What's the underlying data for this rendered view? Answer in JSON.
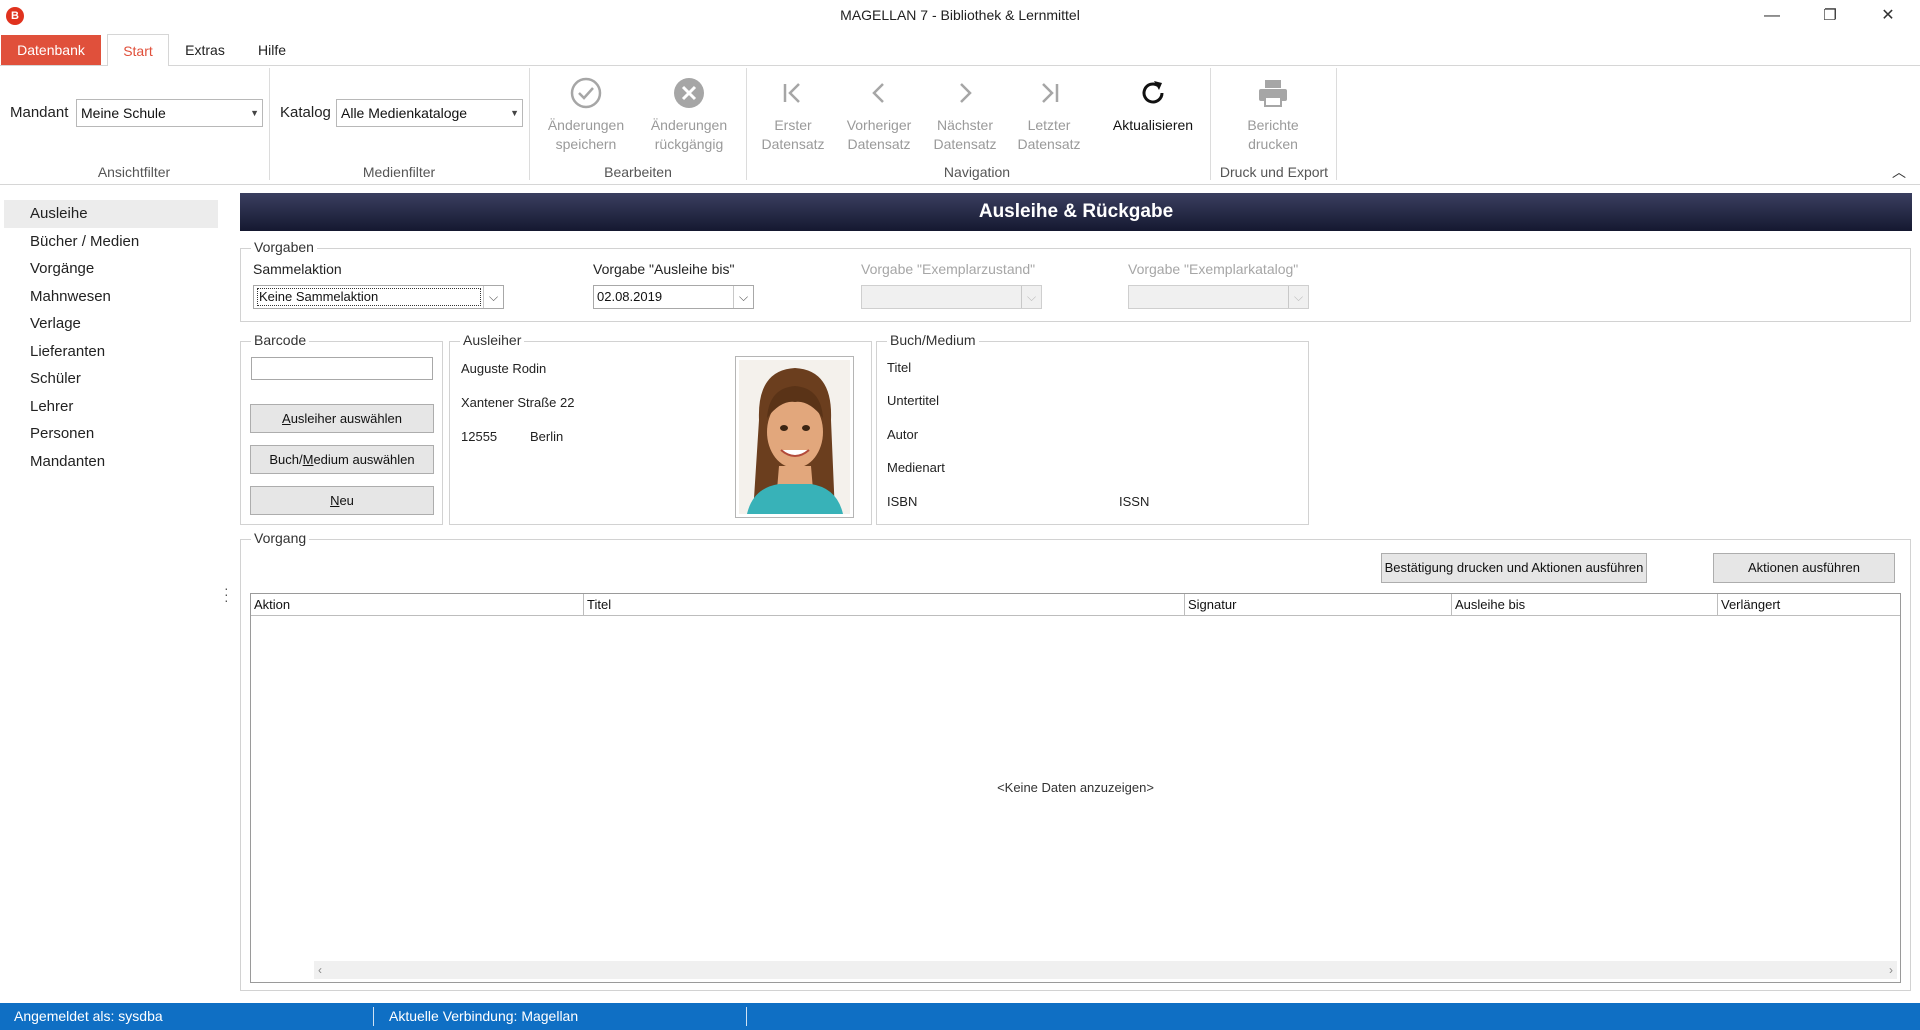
{
  "window": {
    "title": "MAGELLAN 7 - Bibliothek & Lernmittel",
    "app_icon_letter": "B",
    "minimize": "—",
    "restore": "❐",
    "close": "✕"
  },
  "ribbon_tabs": {
    "datenbank": "Datenbank",
    "start": "Start",
    "extras": "Extras",
    "hilfe": "Hilfe"
  },
  "ribbon": {
    "mandant_label": "Mandant",
    "mandant_value": "Meine Schule",
    "ansichtfilter_label": "Ansichtfilter",
    "katalog_label": "Katalog",
    "katalog_value": "Alle Medienkataloge",
    "medienfilter_label": "Medienfilter",
    "save_line1": "Änderungen",
    "save_line2": "speichern",
    "undo_line1": "Änderungen",
    "undo_line2": "rückgängig",
    "bearbeiten_label": "Bearbeiten",
    "first_line1": "Erster",
    "first_line2": "Datensatz",
    "prev_line1": "Vorheriger",
    "prev_line2": "Datensatz",
    "next_line1": "Nächster",
    "next_line2": "Datensatz",
    "last_line1": "Letzter",
    "last_line2": "Datensatz",
    "navigation_label": "Navigation",
    "refresh_label": "Aktualisieren",
    "reports_line1": "Berichte",
    "reports_line2": "drucken",
    "druck_export_label": "Druck und Export",
    "accent_color": "#e0503b"
  },
  "sidebar": {
    "items": [
      {
        "label": "Ausleihe",
        "selected": true
      },
      {
        "label": "Bücher / Medien"
      },
      {
        "label": "Vorgänge"
      },
      {
        "label": "Mahnwesen"
      },
      {
        "label": "Verlage"
      },
      {
        "label": "Lieferanten"
      },
      {
        "label": "Schüler"
      },
      {
        "label": "Lehrer"
      },
      {
        "label": "Personen"
      },
      {
        "label": "Mandanten"
      }
    ]
  },
  "main": {
    "header": "Ausleihe & Rückgabe",
    "vorgaben": {
      "title": "Vorgaben",
      "sammelaktion_label": "Sammelaktion",
      "sammelaktion_value": "Keine Sammelaktion",
      "ausleihe_bis_label": "Vorgabe \"Ausleihe bis\"",
      "ausleihe_bis_value": "02.08.2019",
      "exemplarzustand_label": "Vorgabe \"Exemplarzustand\"",
      "exemplarkatalog_label": "Vorgabe \"Exemplarkatalog\""
    },
    "barcode": {
      "title": "Barcode",
      "input_value": "",
      "btn_ausleiher_pre": "",
      "btn_ausleiher_u": "A",
      "btn_ausleiher_post": "usleiher auswählen",
      "btn_buch_pre": "Buch/",
      "btn_buch_u": "M",
      "btn_buch_post": "edium auswählen",
      "btn_neu_pre": "",
      "btn_neu_u": "N",
      "btn_neu_post": "eu"
    },
    "ausleiher": {
      "title": "Ausleiher",
      "name": "Auguste Rodin",
      "street": "Xantener Straße 22",
      "zip": "12555",
      "city": "Berlin"
    },
    "buch": {
      "title": "Buch/Medium",
      "titel": "Titel",
      "untertitel": "Untertitel",
      "autor": "Autor",
      "medienart": "Medienart",
      "isbn": "ISBN",
      "issn": "ISSN"
    },
    "vorgang": {
      "title": "Vorgang",
      "btn_confirm": "Bestätigung drucken und Aktionen ausführen",
      "btn_execute": "Aktionen ausführen",
      "columns": [
        "Aktion",
        "Titel",
        "Signatur",
        "Ausleihe bis",
        "Verlängert"
      ],
      "empty_text": "<Keine Daten anzuzeigen>"
    }
  },
  "statusbar": {
    "user": "Angemeldet als: sysdba",
    "connection": "Aktuelle Verbindung: Magellan",
    "color": "#0f6fc4"
  }
}
